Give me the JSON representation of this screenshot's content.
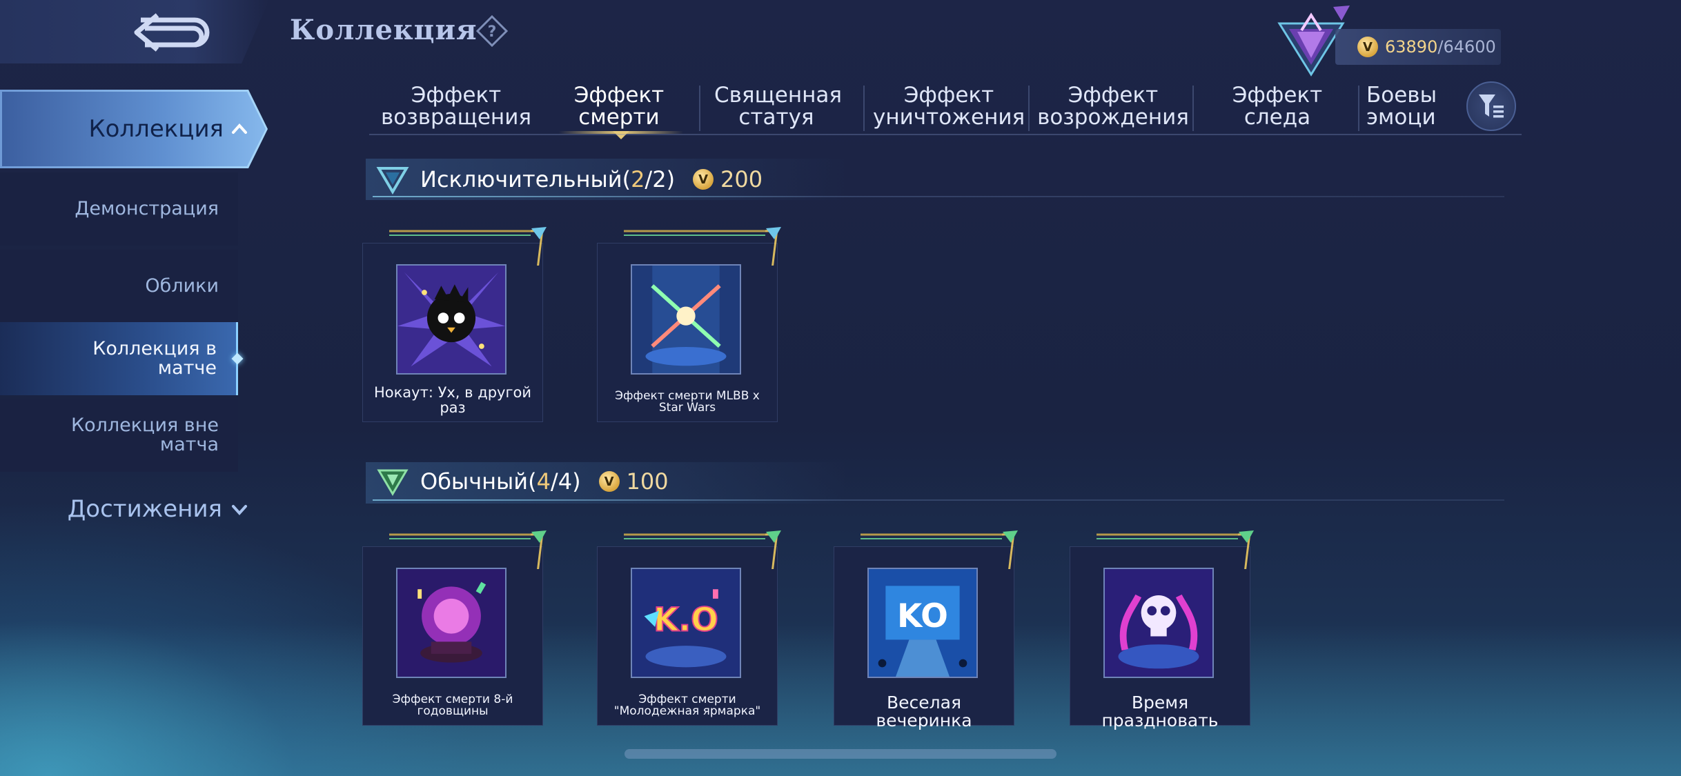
{
  "header": {
    "title": "Коллекция",
    "points_current": "63890",
    "points_separator": "/",
    "points_max": "64600"
  },
  "sidebar": {
    "main_label": "Коллекция",
    "items": [
      {
        "label": "Демонстрация"
      },
      {
        "label": "Облики"
      },
      {
        "label": "Коллекция в матче",
        "active": true
      },
      {
        "label": "Коллекция вне матча"
      }
    ],
    "achievements_label": "Достижения"
  },
  "tabs": [
    {
      "label": "Эффект возвращения"
    },
    {
      "label": "Эффект смерти",
      "active": true
    },
    {
      "label": "Священная статуя"
    },
    {
      "label": "Эффект уничтожения"
    },
    {
      "label": "Эффект возрождения"
    },
    {
      "label": "Эффект следа"
    },
    {
      "label": "Боевые эмоции"
    }
  ],
  "sections": [
    {
      "title": "Исключительный",
      "count_open": "(",
      "count_owned": "2",
      "count_sep": "/",
      "count_total": "2",
      "count_close": ")",
      "reward": "200",
      "items": [
        {
          "name": "Нокаут: Ух, в другой раз"
        },
        {
          "name": "Эффект смерти MLBB x Star Wars"
        }
      ]
    },
    {
      "title": "Обычный",
      "count_open": "(",
      "count_owned": "4",
      "count_sep": "/",
      "count_total": "4",
      "count_close": ")",
      "reward": "100",
      "items": [
        {
          "name": "Эффект смерти 8-й годовщины"
        },
        {
          "name": "Эффект смерти \"Молодежная ярмарка\""
        },
        {
          "name": "Веселая вечеринка"
        },
        {
          "name": "Время праздновать"
        }
      ]
    }
  ],
  "icons": {
    "back": "back-arrow-icon",
    "help": "question-mark-icon",
    "filter": "filter-icon",
    "coin": "coin-icon"
  },
  "colors": {
    "accent_gold": "#f0c97a",
    "active_blue": "#8fc0ef"
  }
}
